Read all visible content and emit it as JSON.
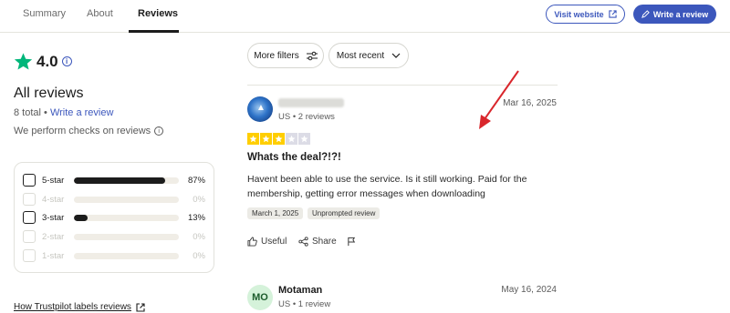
{
  "nav": {
    "tabs": [
      {
        "label": "Summary"
      },
      {
        "label": "About"
      },
      {
        "label": "Reviews"
      }
    ],
    "visit_label": "Visit website",
    "write_label": "Write a review"
  },
  "summary": {
    "rating": "4.0",
    "heading": "All reviews",
    "total": "8 total",
    "separator": "•",
    "write_link": "Write a review",
    "checks_text": "We perform checks on reviews",
    "distribution": [
      {
        "label": "5-star",
        "percent": 87,
        "pct_text": "87%",
        "enabled": true
      },
      {
        "label": "4-star",
        "percent": 0,
        "pct_text": "0%",
        "enabled": false
      },
      {
        "label": "3-star",
        "percent": 13,
        "pct_text": "13%",
        "enabled": true
      },
      {
        "label": "2-star",
        "percent": 0,
        "pct_text": "0%",
        "enabled": false
      },
      {
        "label": "1-star",
        "percent": 0,
        "pct_text": "0%",
        "enabled": false
      }
    ],
    "labels_link": "How Trustpilot labels reviews"
  },
  "filters": {
    "more_filters": "More filters",
    "sort": "Most recent"
  },
  "reviews": [
    {
      "meta": "US • 2 reviews",
      "date": "Mar 16, 2025",
      "stars": 3,
      "title": "Whats the deal?!?!",
      "body": "Havent been able to use the service. Is it still working. Paid for the membership, getting error messages when downloading",
      "tags": [
        "March 1, 2025",
        "Unprompted review"
      ],
      "useful": "Useful",
      "share": "Share"
    },
    {
      "initials": "MO",
      "name": "Motaman",
      "meta": "US • 1 review",
      "date": "May 16, 2024"
    }
  ],
  "colors": {
    "brand_blue": "#3c57bc",
    "star_green": "#00b67a",
    "star_yellow": "#ffce00",
    "arrow_red": "#d9262c"
  }
}
